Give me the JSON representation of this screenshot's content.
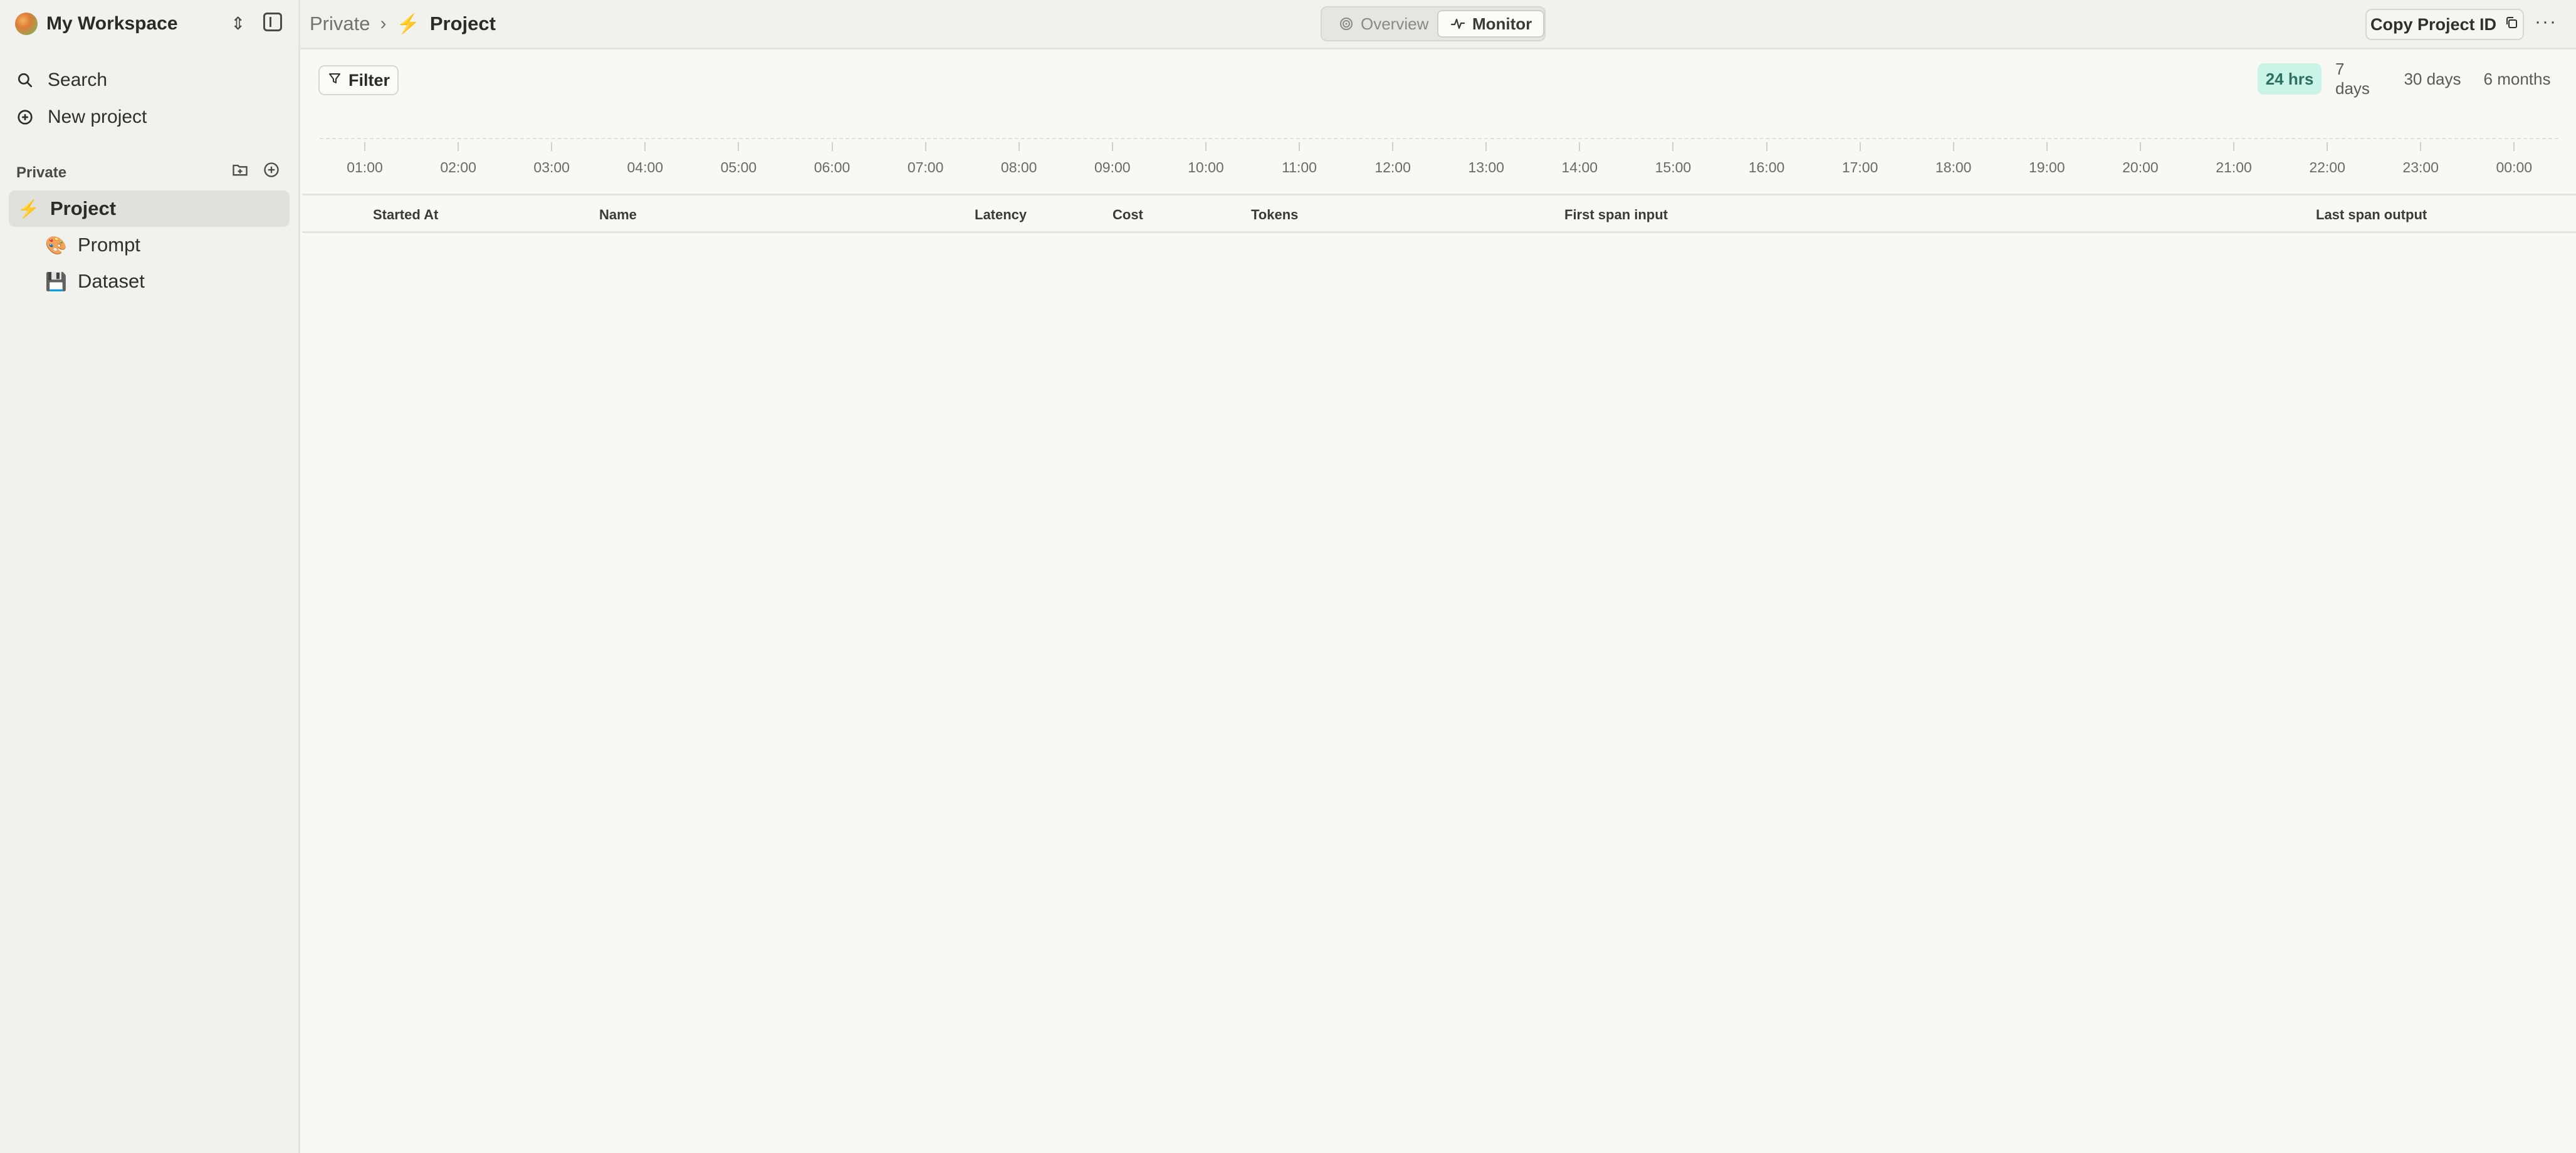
{
  "workspace": {
    "name": "My Workspace",
    "switch_icon": "chevron-up-down-icon",
    "panel_icon": "sidebar-toggle-icon"
  },
  "sidebar": {
    "links": [
      {
        "label": "Search",
        "icon": "search-icon"
      },
      {
        "label": "New project",
        "icon": "plus-circle-icon"
      }
    ],
    "section_label": "Private",
    "section_actions": [
      "new-folder-icon",
      "add-item-icon"
    ],
    "tree": [
      {
        "label": "Project",
        "emoji": "⚡",
        "active": true
      },
      {
        "label": "Prompt",
        "emoji": "🎨",
        "active": false
      },
      {
        "label": "Dataset",
        "emoji": "💾",
        "active": false
      }
    ]
  },
  "topbar": {
    "breadcrumb": {
      "root": "Private",
      "separator": "›",
      "current_icon": "⚡",
      "current": "Project"
    },
    "tabs": [
      {
        "label": "Overview",
        "icon": "target-icon",
        "active": false
      },
      {
        "label": "Monitor",
        "icon": "activity-icon",
        "active": true
      }
    ],
    "copy_button": "Copy Project ID",
    "copy_icon": "copy-icon",
    "more_icon": "···"
  },
  "main": {
    "filter_label": "Filter",
    "ranges": [
      {
        "label": "24 hrs",
        "active": true
      },
      {
        "label": "7 days",
        "active": false
      },
      {
        "label": "30 days",
        "active": false
      },
      {
        "label": "6 months",
        "active": false
      }
    ],
    "timeline_ticks": [
      "01:00",
      "02:00",
      "03:00",
      "04:00",
      "05:00",
      "06:00",
      "07:00",
      "08:00",
      "09:00",
      "10:00",
      "11:00",
      "12:00",
      "13:00",
      "14:00",
      "15:00",
      "16:00",
      "17:00",
      "18:00",
      "19:00",
      "20:00",
      "21:00",
      "22:00",
      "23:00",
      "00:00"
    ],
    "table_columns": [
      "Started At",
      "Name",
      "Latency",
      "Cost",
      "Tokens",
      "First span input",
      "Last span output"
    ]
  },
  "colors": {
    "accent": "#c9f4e7",
    "accent_text": "#2f6f5f",
    "sidebar_bg": "#f1f1ee",
    "content_bg": "#f8f8f4"
  }
}
